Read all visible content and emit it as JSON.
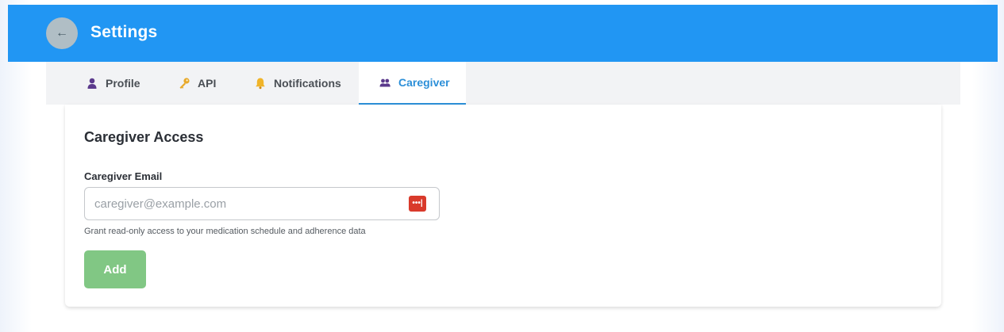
{
  "header": {
    "title": "Settings",
    "back_glyph": "←"
  },
  "tabs": [
    {
      "label": "Profile",
      "icon": "person-icon",
      "active": false
    },
    {
      "label": "API",
      "icon": "key-icon",
      "active": false
    },
    {
      "label": "Notifications",
      "icon": "bell-icon",
      "active": false
    },
    {
      "label": "Caregiver",
      "icon": "people-icon",
      "active": true
    }
  ],
  "caregiver": {
    "title": "Caregiver Access",
    "email_label": "Caregiver Email",
    "email_placeholder": "caregiver@example.com",
    "email_value": "",
    "hint": "Grant read-only access to your medication schedule and adherence data",
    "add_label": "Add",
    "password_manager_glyph": "•••|"
  },
  "colors": {
    "header_bg": "#2196f3",
    "accent": "#2c8fd8",
    "add_button": "#81c784",
    "password_manager_icon": "#d93a2b"
  }
}
